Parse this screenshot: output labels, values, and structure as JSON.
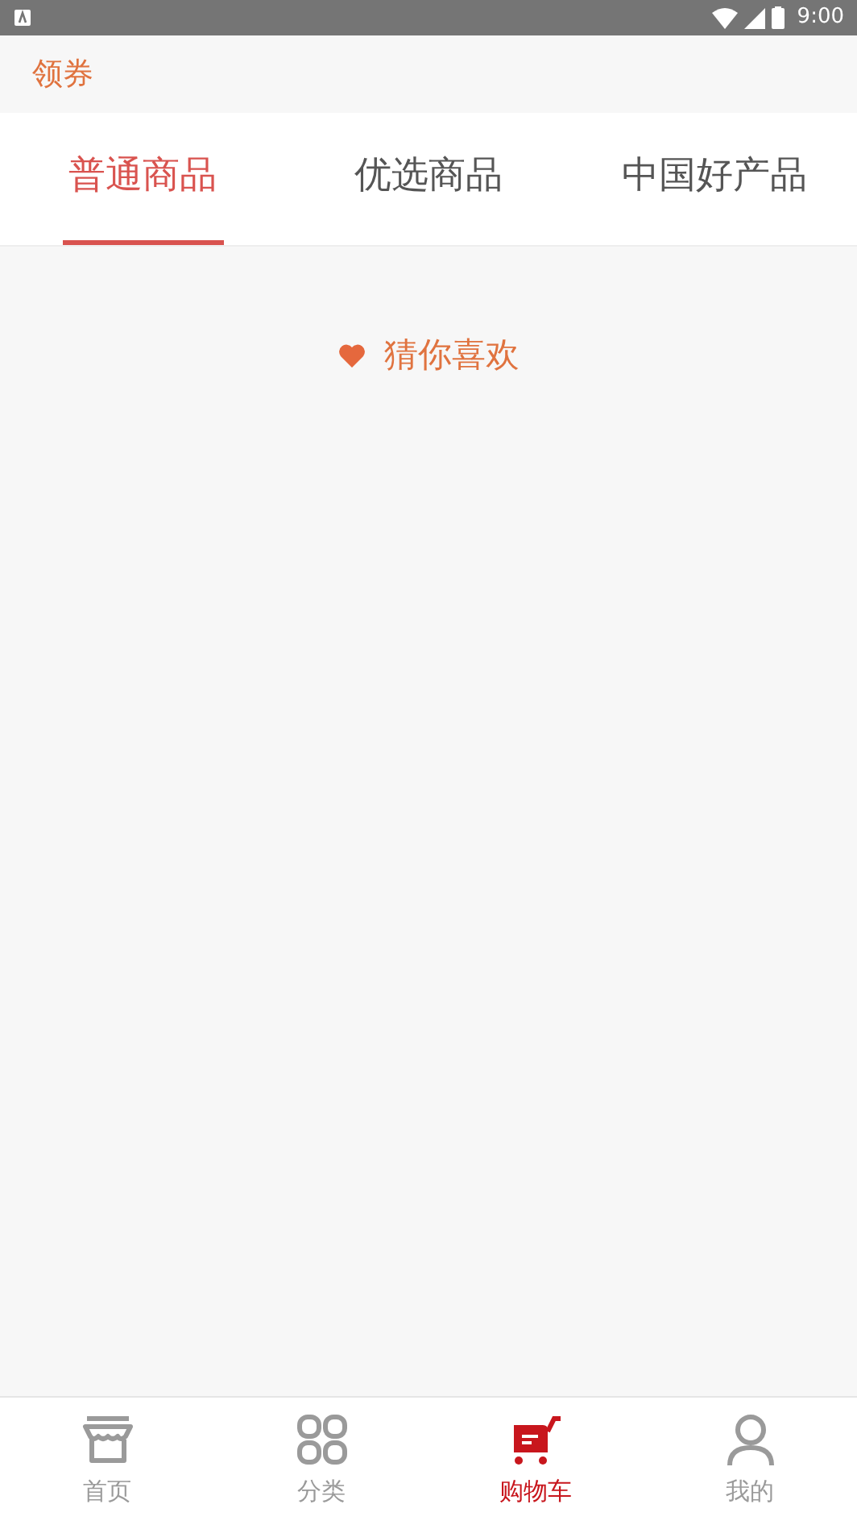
{
  "status_bar": {
    "time": "9:00"
  },
  "header": {
    "title": "领券"
  },
  "tabs": [
    {
      "label": "普通商品",
      "selected": true
    },
    {
      "label": "优选商品",
      "selected": false
    },
    {
      "label": "中国好产品",
      "selected": false
    }
  ],
  "recommend": {
    "title": "猜你喜欢"
  },
  "bottom_nav": [
    {
      "kind": "home",
      "label": "首页",
      "selected": false
    },
    {
      "kind": "category",
      "label": "分类",
      "selected": false
    },
    {
      "kind": "cart",
      "label": "购物车",
      "selected": true
    },
    {
      "kind": "profile",
      "label": "我的",
      "selected": false
    }
  ]
}
